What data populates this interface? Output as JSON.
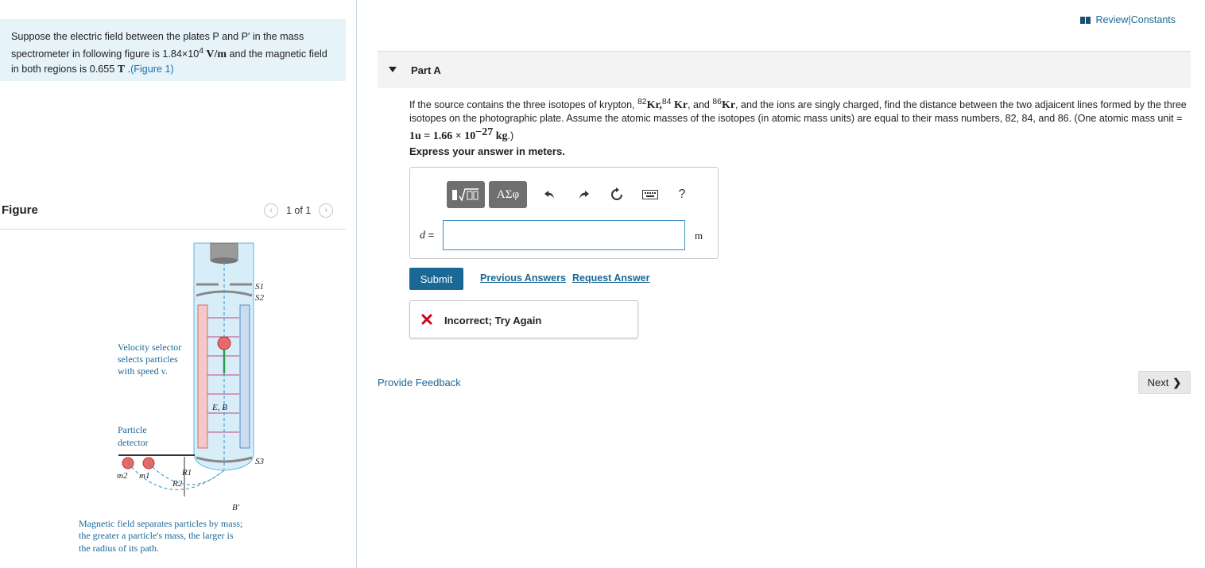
{
  "problem": {
    "text_a": "Suppose the electric field between the plates P and P′ in the mass spectrometer in following figure is 1.84×10",
    "exp_a": "4",
    "unit_a": " V/m",
    "text_b": " and the magnetic field in both regions is 0.655 ",
    "unit_b": "T",
    "text_c": " .",
    "figure_link": "(Figure 1)"
  },
  "figure_panel": {
    "title": "Figure",
    "pager": "1 of 1",
    "labels": {
      "s1": "S1",
      "s2": "S2",
      "s3": "S3",
      "velocity_1": "Velocity selector",
      "velocity_2": "selects particles",
      "velocity_3": "with speed v.",
      "detector_1": "Particle",
      "detector_2": "detector",
      "eb": "E, B",
      "bprime": "B′",
      "m2": "m2",
      "m1": "m1",
      "r1": "R1",
      "r2": "R2",
      "caption_1": "Magnetic field separates particles by mass;",
      "caption_2": "the greater a particle's mass, the larger is",
      "caption_3": "the radius of its path."
    }
  },
  "header": {
    "review": "Review",
    "sep": " | ",
    "constants": "Constants"
  },
  "part": {
    "title": "Part A"
  },
  "question": {
    "t1": "If the source contains the three isotopes of krypton, ",
    "iso1_mass": "82",
    "iso1": "Kr",
    "comma": ",",
    "iso2_mass": "84",
    "iso2": " Kr",
    "and": ", and ",
    "iso3_mass": "86",
    "iso3": "Kr",
    "t2": ", and the ions are singly charged, find the distance between the two adjaicent lines formed by the three isotopes on the photographic plate. Assume the atomic masses of the isotopes (in atomic mass units) are equal to their mass numbers, 82, 84, and 86. (One atomic mass unit = ",
    "amu": "1u = 1.66 × 10",
    "amu_exp": "−27",
    "amu_unit": " kg",
    "t3": ".)"
  },
  "express": "Express your answer in meters.",
  "answer": {
    "var": "d",
    "eq": " =",
    "value": "",
    "unit": "m",
    "greek_button": "ΑΣφ",
    "help": "?"
  },
  "actions": {
    "submit": "Submit",
    "previous": "Previous Answers",
    "request": "Request Answer"
  },
  "feedback": {
    "status": "Incorrect; Try Again"
  },
  "footer": {
    "provide_feedback": "Provide Feedback",
    "next": "Next"
  },
  "colors": {
    "link": "#1a6896",
    "submit": "#1a6896",
    "problem_bg": "#e6f3f8",
    "error": "#d0021b",
    "toolbar_btn": "#6f6f6f"
  },
  "icons": [
    "book-icon",
    "chevron-left-icon",
    "chevron-right-icon",
    "matrix-sqrt-icon",
    "undo-icon",
    "redo-icon",
    "reset-icon",
    "keyboard-icon",
    "help-icon",
    "x-mark-icon",
    "chevron-right-bold-icon"
  ]
}
